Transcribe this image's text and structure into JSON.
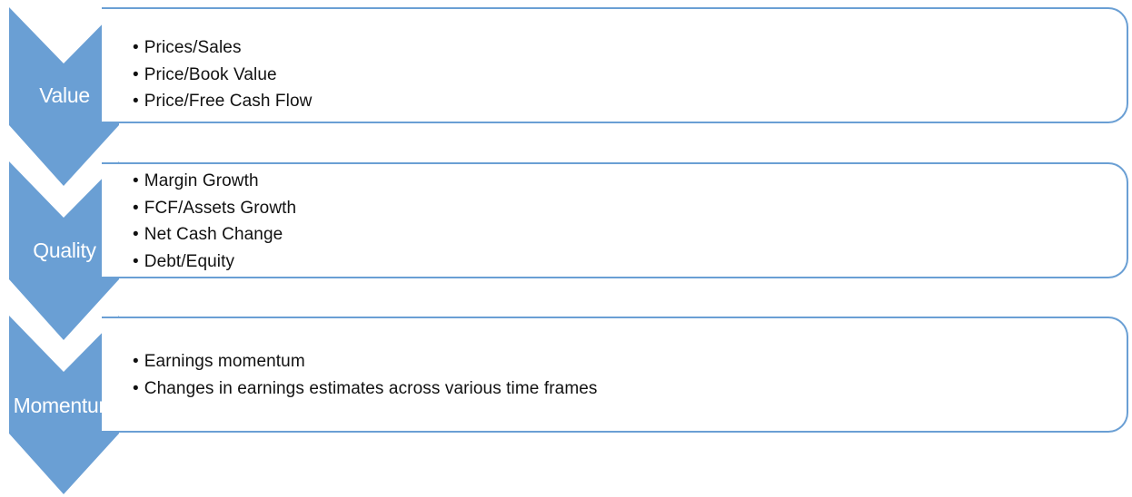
{
  "colors": {
    "chevron_fill": "#6a9fd4",
    "panel_border": "#6a9fd4",
    "label_text": "#ffffff",
    "bullet_text": "#111111"
  },
  "stages": [
    {
      "label": "Value",
      "bullets": [
        "Prices/Sales",
        "Price/Book Value",
        "Price/Free Cash Flow"
      ]
    },
    {
      "label": "Quality",
      "bullets": [
        "Margin Growth",
        "FCF/Assets Growth",
        "Net Cash Change",
        "Debt/Equity"
      ]
    },
    {
      "label": "Momentum",
      "bullets": [
        "Earnings momentum",
        "Changes in earnings estimates across various time frames"
      ]
    }
  ]
}
